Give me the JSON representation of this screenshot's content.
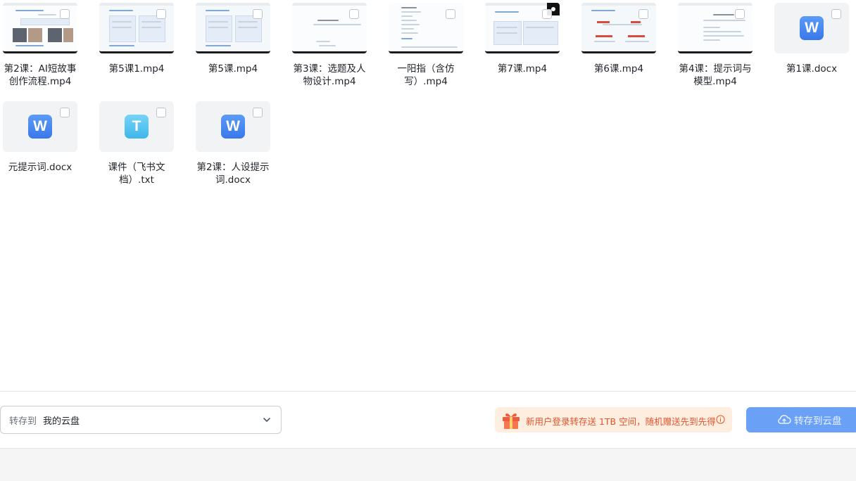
{
  "files": [
    {
      "name": "第2课：AI短故事创作流程.mp4",
      "kind": "video"
    },
    {
      "name": "第5课1.mp4",
      "kind": "video"
    },
    {
      "name": "第5课.mp4",
      "kind": "video"
    },
    {
      "name": "第3课：选题及人物设计.mp4",
      "kind": "video"
    },
    {
      "name": "一阳指（含仿写）.mp4",
      "kind": "video"
    },
    {
      "name": "第7课.mp4",
      "kind": "video"
    },
    {
      "name": "第6课.mp4",
      "kind": "video"
    },
    {
      "name": "第4课：提示词与模型.mp4",
      "kind": "video"
    },
    {
      "name": "第1课.docx",
      "kind": "doc",
      "badge": "W"
    },
    {
      "name": "元提示词.docx",
      "kind": "doc",
      "badge": "W"
    },
    {
      "name": "课件（飞书文档）.txt",
      "kind": "txt",
      "badge": "T"
    },
    {
      "name": "第2课：人设提示词.docx",
      "kind": "doc",
      "badge": "W"
    }
  ],
  "footer": {
    "dest_label": "转存到",
    "dest_value": "我的云盘",
    "promo_text": "新用户登录转存送 1TB 空间，随机赠送先到先得",
    "save_button": "转存到云盘"
  },
  "colors": {
    "accent": "#6aa1f7",
    "promo_bg": "#fdeee0",
    "promo_text": "#e2542c",
    "doc_icon": "#3a78ea",
    "txt_icon": "#3fb6ea"
  },
  "icons": {
    "dest_chevron": "chevron-down-icon",
    "promo_gift": "gift-icon",
    "promo_info": "info-icon",
    "save_cloud": "cloud-upload-icon",
    "doc_badge": "word-doc-icon",
    "txt_badge": "text-file-icon"
  }
}
